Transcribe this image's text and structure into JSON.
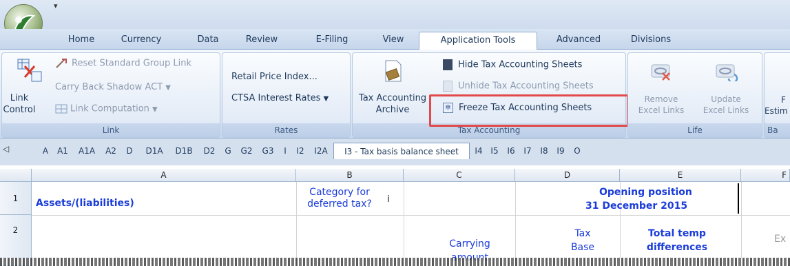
{
  "quick_access": "▾",
  "tabs": [
    "Home",
    "Currency",
    "Data",
    "Review",
    "E-Filing",
    "View",
    "Application Tools",
    "Advanced",
    "Divisions"
  ],
  "groups": {
    "link": {
      "label": "Link",
      "big_button": "Link Control",
      "items": [
        "Reset Standard Group Link",
        "Carry Back Shadow ACT",
        "Link Computation"
      ]
    },
    "rates": {
      "label": "Rates",
      "items": [
        "Retail Price Index...",
        "CTSA Interest Rates"
      ]
    },
    "tax_accounting": {
      "label": "Tax Accounting",
      "big_button": "Tax Accounting Archive",
      "items": [
        "Hide Tax Accounting Sheets",
        "Unhide Tax Accounting Sheets",
        "Freeze Tax Accounting Sheets"
      ]
    },
    "life": {
      "label": "Life",
      "remove": "Remove Excel Links",
      "update": "Update Excel Links"
    },
    "partial": {
      "label": "Ba",
      "button": "Estim"
    }
  },
  "sheet_tabs": [
    "A",
    "A1",
    "A1A",
    "A2",
    "D",
    "D1A",
    "D1B",
    "D2",
    "G",
    "G2",
    "G3",
    "I",
    "I2",
    "I2A",
    "I3 - Tax basis balance sheet",
    "I4",
    "I5",
    "I6",
    "I7",
    "I8",
    "I9",
    "O"
  ],
  "active_sheet": "I3 - Tax basis balance sheet",
  "columns": [
    "A",
    "B",
    "C",
    "D",
    "E",
    "F"
  ],
  "rows": [
    "1",
    "2"
  ],
  "cells": {
    "a1": "Assets/(liabilities)",
    "b1": "Category for deferred tax?",
    "b1_marker": "i",
    "e1_line1": "Opening position",
    "e1_line2": "31 December 2015",
    "c2": "Carrying amount",
    "d2": "Tax Base",
    "e2": "Total temp differences",
    "f2": "Ex"
  },
  "colors": {
    "accent_box": "#e24a4a",
    "cell_text": "#1a3cd9"
  }
}
